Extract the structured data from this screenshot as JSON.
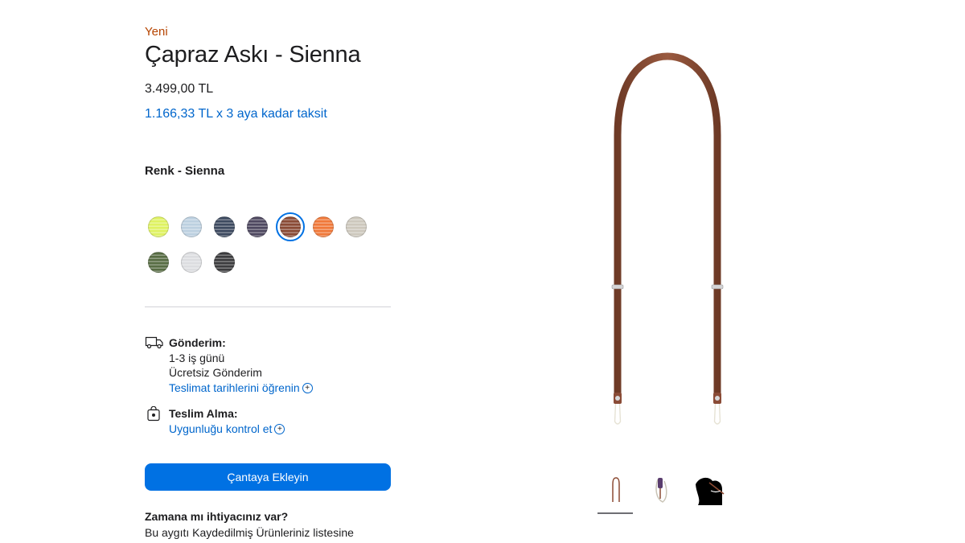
{
  "product": {
    "badge": "Yeni",
    "title": "Çapraz Askı - Sienna",
    "price": "3.499,00 TL",
    "installment": "1.166,33 TL x 3 aya kadar taksit"
  },
  "color": {
    "label": "Renk - Sienna",
    "selected_index": 4,
    "swatches": [
      {
        "name": "lime",
        "hex": "#dff262"
      },
      {
        "name": "light-blue",
        "hex": "#bcd0e0"
      },
      {
        "name": "navy",
        "hex": "#3d4a60"
      },
      {
        "name": "purple",
        "hex": "#4e4860"
      },
      {
        "name": "sienna",
        "hex": "#8a4b36"
      },
      {
        "name": "orange",
        "hex": "#f0793a"
      },
      {
        "name": "stone",
        "hex": "#cdc8bd"
      },
      {
        "name": "green",
        "hex": "#586d44"
      },
      {
        "name": "silver",
        "hex": "#dcdde0"
      },
      {
        "name": "black",
        "hex": "#3c3c3e"
      }
    ]
  },
  "shipping": {
    "heading": "Gönderim:",
    "line1": "1-3 iş günü",
    "line2": "Ücretsiz Gönderim",
    "link": "Teslimat tarihlerini öğrenin",
    "icon": "truck-icon"
  },
  "pickup": {
    "heading": "Teslim Alma:",
    "link": "Uygunluğu kontrol et",
    "icon": "store-bag-icon"
  },
  "cart_button": "Çantaya Ekleyin",
  "time_needed": {
    "heading": "Zamana mı ihtiyacınız var?",
    "body": "Bu aygıtı Kaydedilmiş Ürünleriniz listesine"
  },
  "gallery": {
    "selected_index": 0,
    "thumbnails": [
      "strap-full-view",
      "strap-detail-view",
      "strap-lifestyle-view"
    ]
  },
  "colors": {
    "accent": "#0071e3",
    "link": "#0066cc",
    "badge": "#b64400",
    "strap": "#8b4a33"
  }
}
